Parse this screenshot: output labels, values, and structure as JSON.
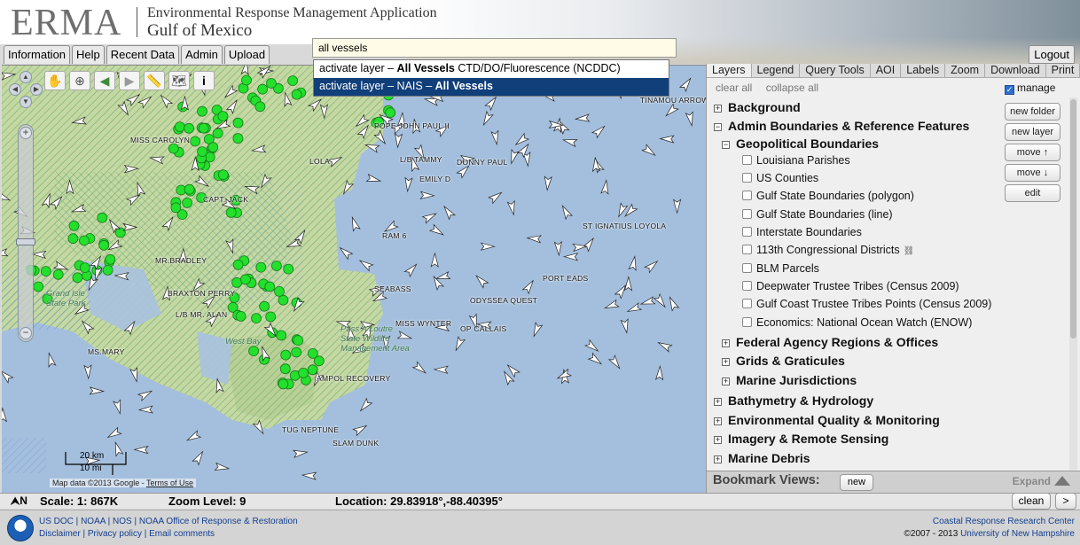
{
  "header": {
    "logo": "ERMA",
    "title": "Environmental Response Management Application",
    "subtitle": "Gulf of Mexico",
    "logout_label": "Logout"
  },
  "main_tabs": [
    "Information",
    "Help",
    "Recent Data",
    "Admin",
    "Upload"
  ],
  "search": {
    "value": "all vessels",
    "suggestions": [
      {
        "prefix": "activate layer – ",
        "bold": "All Vessels",
        "suffix": " CTD/DO/Fluorescence (NCDDC)",
        "active": false
      },
      {
        "prefix": "activate layer – NAIS – ",
        "bold": "All Vessels",
        "suffix": "",
        "active": true
      }
    ]
  },
  "map": {
    "vessel_labels": [
      "TINAMOU ARROW",
      "POPE JOHN PAUL II",
      "MISS CAROLYN",
      "LOLA",
      "L/B TAMMY",
      "DONNY PAUL",
      "EMILY D",
      "CAPT. JACK",
      "ST IGNATIUS LOYOLA",
      "RAM 6",
      "MR.BRADLEY",
      "PORT EADS",
      "SEABASS",
      "ODYSSEA QUEST",
      "BRAXTON PERRY",
      "L/B MR. ALAN",
      "MISS WYNTER",
      "OP CALLAIS",
      "MS.MARY",
      "AMPOL RECOVERY",
      "TUG NEPTUNE",
      "SLAM DUNK"
    ],
    "park_labels": {
      "grand_isle": "Grand Isle\nState Park",
      "west_bay": "West Bay",
      "pass_a_loutre": "Pass A Loutre\nState Wildlife\nManagement Area"
    },
    "scale_km": "20 km",
    "scale_mi": "10 mi",
    "attribution": "Map data ©2013 Google - ",
    "terms_link": "Terms of Use",
    "colors": {
      "water": "#a4bfdd",
      "land": "#c5d8a2",
      "hatch": "#58a06a",
      "vessel_point": "#22e02b"
    }
  },
  "panel": {
    "tabs": [
      "Layers",
      "Legend",
      "Query Tools",
      "AOI",
      "Labels",
      "Zoom",
      "Download",
      "Print"
    ],
    "active_tab": "Layers",
    "clear_all": "clear all",
    "collapse_all": "collapse all",
    "manage_label": "manage",
    "side_buttons": [
      "new folder",
      "new layer",
      "move ↑",
      "move ↓",
      "edit"
    ],
    "tree": [
      {
        "level": 1,
        "label": "Background",
        "expander": "+"
      },
      {
        "level": 1,
        "label": "Admin Boundaries & Reference Features",
        "expander": "−"
      },
      {
        "level": 2,
        "label": "Geopolitical Boundaries",
        "expander": "−"
      },
      {
        "level": 3,
        "label": "Louisiana Parishes"
      },
      {
        "level": 3,
        "label": "US Counties"
      },
      {
        "level": 3,
        "label": "Gulf State Boundaries (polygon)"
      },
      {
        "level": 3,
        "label": "Gulf State Boundaries (line)"
      },
      {
        "level": 3,
        "label": "Interstate Boundaries"
      },
      {
        "level": 3,
        "label": "113th Congressional Districts",
        "link": true
      },
      {
        "level": 3,
        "label": "BLM Parcels"
      },
      {
        "level": 3,
        "label": "Deepwater Trustee Tribes (Census 2009)"
      },
      {
        "level": 3,
        "label": "Gulf Coast Trustee Tribes Points (Census 2009)"
      },
      {
        "level": 3,
        "label": "Economics: National Ocean Watch (ENOW)"
      },
      {
        "level": 2,
        "label": "Federal Agency Regions & Offices",
        "expander": "+"
      },
      {
        "level": 2,
        "label": "Grids & Graticules",
        "expander": "+"
      },
      {
        "level": 2,
        "label": "Marine Jurisdictions",
        "expander": "+"
      },
      {
        "level": 1,
        "label": "Bathymetry & Hydrology",
        "expander": "+"
      },
      {
        "level": 1,
        "label": "Environmental Quality & Monitoring",
        "expander": "+"
      },
      {
        "level": 1,
        "label": "Imagery & Remote Sensing",
        "expander": "+"
      },
      {
        "level": 1,
        "label": "Marine Debris",
        "expander": "+"
      }
    ],
    "bookmark_label": "Bookmark Views:",
    "bookmark_new": "new",
    "expand_label": "Expand"
  },
  "status": {
    "north": "⮝N",
    "scale": "Scale: 1: 867K",
    "zoom": "Zoom Level: 9",
    "location_label": "Location:",
    "location_value": "29.83918°,-88.40395°",
    "clean_label": "clean",
    "next_label": ">"
  },
  "footer": {
    "line1": [
      "US DOC",
      "NOAA",
      "NOS",
      "NOAA Office of Response & Restoration"
    ],
    "line2": [
      "Disclaimer",
      "Privacy policy",
      "Email comments"
    ],
    "right1": "Coastal Response Research Center",
    "right2_prefix": "©2007 - 2013 ",
    "right2_link": "University of New Hampshire"
  }
}
